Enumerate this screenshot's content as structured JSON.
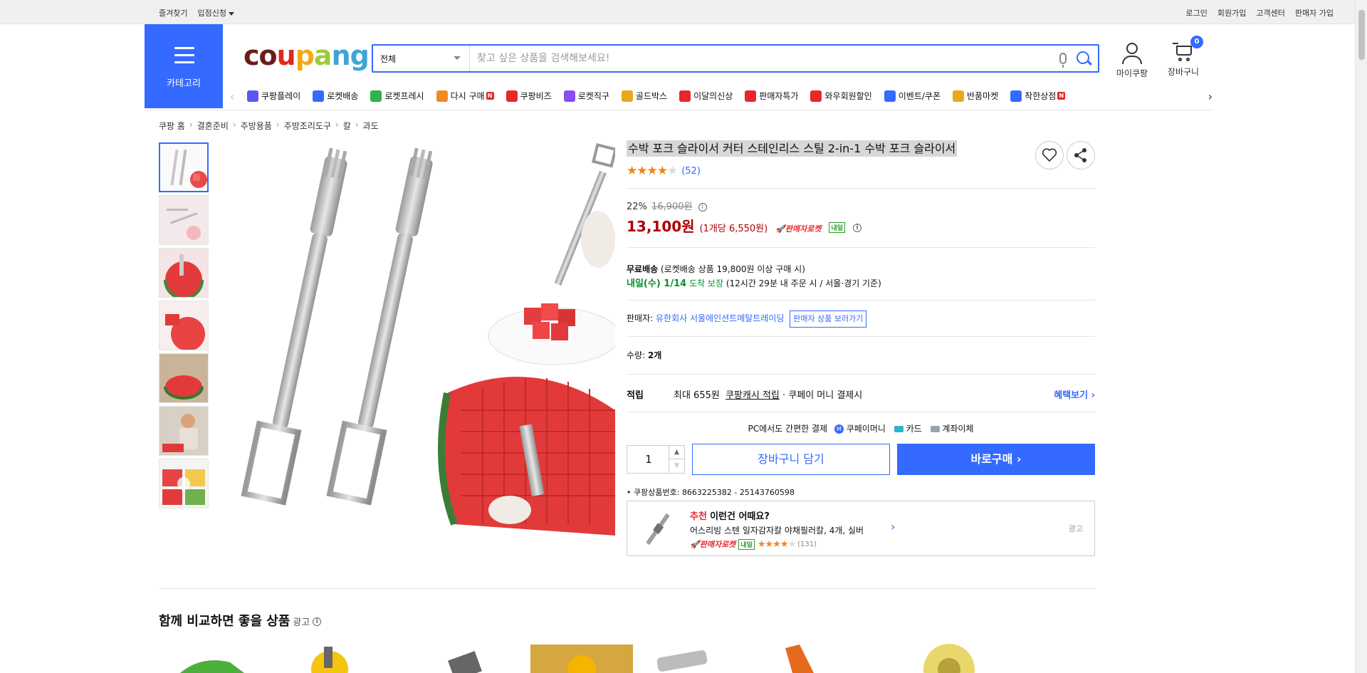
{
  "topbar": {
    "left": [
      "즐겨찾기",
      "입점신청"
    ],
    "right": [
      "로그인",
      "회원가입",
      "고객센터",
      "판매자 가입"
    ]
  },
  "category_button": "카테고리",
  "logo_text": "coupang",
  "search": {
    "category": "전체",
    "placeholder": "찾고 싶은 상품을 검색해보세요!"
  },
  "header_icons": {
    "mycoupang": "마이쿠팡",
    "cart": "장바구니",
    "cart_count": "0"
  },
  "nav": [
    {
      "label": "쿠팡플레이",
      "icon": "play-icon",
      "color": "#5b57f5"
    },
    {
      "label": "로켓배송",
      "icon": "rocket-icon",
      "color": "#346aff"
    },
    {
      "label": "로켓프레시",
      "icon": "rocket-fresh-icon",
      "color": "#2fb34a"
    },
    {
      "label": "다시 구매",
      "icon": "repurchase-icon",
      "color": "#f08a24",
      "badge": "N"
    },
    {
      "label": "쿠팡비즈",
      "icon": "biz-icon",
      "color": "#e8262c",
      "prefix": "biz"
    },
    {
      "label": "로켓직구",
      "icon": "global-icon",
      "color": "#8a4df0"
    },
    {
      "label": "골드박스",
      "icon": "goldbox-icon",
      "color": "#e8a81c"
    },
    {
      "label": "이달의신상",
      "icon": "new-icon",
      "color": "#e8262c"
    },
    {
      "label": "판매자특가",
      "icon": "sale-icon",
      "color": "#e8262c"
    },
    {
      "label": "와우회원할인",
      "icon": "wow-icon",
      "color": "#e8262c"
    },
    {
      "label": "이벤트/쿠폰",
      "icon": "coupon-icon",
      "color": "#346aff"
    },
    {
      "label": "반품마켓",
      "icon": "return-market-icon",
      "color": "#e8a81c"
    },
    {
      "label": "착한상점",
      "icon": "good-store-icon",
      "color": "#346aff",
      "badge": "N"
    }
  ],
  "breadcrumb": [
    "쿠팡 홈",
    "결혼준비",
    "주방용품",
    "주방조리도구",
    "칼",
    "과도"
  ],
  "product": {
    "title": "수박 포크 슬라이서 커터 스테인리스 스틸 2-in-1 수박 포크 슬라이서",
    "rating": 4,
    "rating_max": 5,
    "review_count": "(52)",
    "discount": "22%",
    "original_price": "16,900원",
    "price": "13,100원",
    "unit_price": "(1개당 6,550원)",
    "rocket_label": "판매자로켓",
    "tag_tomorrow": "내일",
    "free_ship_label": "무료배송",
    "free_ship_detail": "(로켓배송 상품 19,800원 이상 구매 시)",
    "arrival": "내일(수) 1/14",
    "arrival_guarantee": "도착 보장",
    "arrival_detail": "(12시간 29분 내 주문 시 / 서울·경기 기준)",
    "seller_label": "판매자:",
    "seller_name": "유한회사 서울에인션트메탈트레이딩",
    "seller_button": "판매자 상품 보러가기",
    "quantity_label": "수량:",
    "quantity_value": "2개",
    "reward_label": "적립",
    "reward_text": "최대 655원",
    "reward_link": "쿠팡캐시 적립",
    "reward_tail": "· 쿠페이 머니 결제시",
    "benefit_link": "혜택보기",
    "pc_pay": "PC에서도 간편한 결제",
    "pay_methods": [
      "쿠페이머니",
      "카드",
      "계좌이체"
    ],
    "qty_input": "1",
    "add_cart": "장바구니 담기",
    "buy_now": "바로구매",
    "product_no_label": "쿠팡상품번호:",
    "product_no": "8663225382 - 25143760598"
  },
  "recommend": {
    "tag": "추천",
    "title": "이런건 어때요?",
    "item": "어스리빙 스텐 일자감자칼 야채필러칼, 4개, 실버",
    "rocket_label": "판매자로켓",
    "tag_tomorrow": "내일",
    "rating": 4,
    "review_count": "(131)",
    "ad": "광고"
  },
  "compare_section": {
    "title": "함께 비교하면 좋을 상품",
    "ad": "광고"
  },
  "colors": {
    "accent": "#346aff",
    "price_red": "#ae0000",
    "green": "#0a8f2a"
  }
}
